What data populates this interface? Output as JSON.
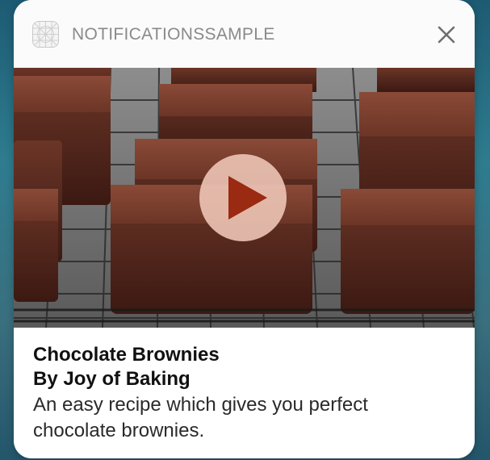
{
  "notification": {
    "app_name": "NOTIFICATIONSSAMPLE",
    "app_icon": "app-grid-icon",
    "close_icon": "close-icon",
    "media": {
      "description_icon": "play-icon",
      "play_color": "#9a2a12",
      "play_background": "#f0c8b9"
    },
    "title": "Chocolate Brownies",
    "subtitle": "By Joy of Baking",
    "body_line_1": "An easy recipe which gives you perfect",
    "body_line_2": "chocolate brownies."
  }
}
